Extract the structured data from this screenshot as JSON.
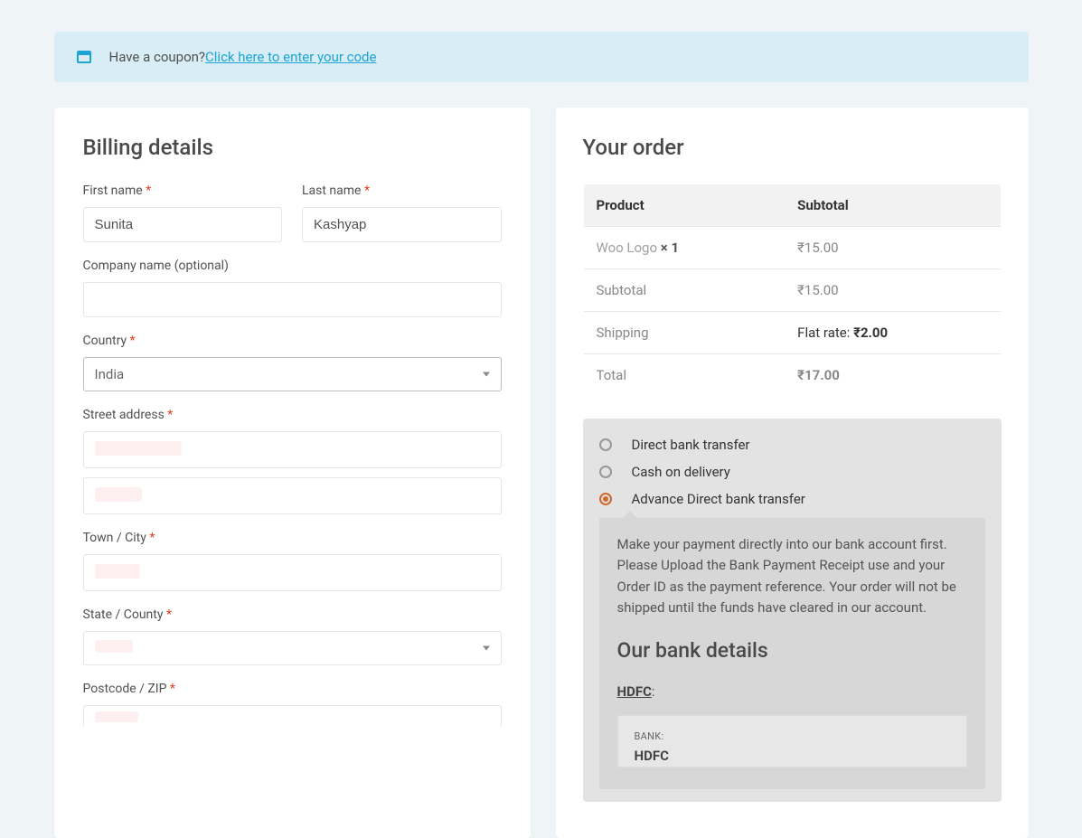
{
  "coupon": {
    "text": "Have a coupon? ",
    "link": "Click here to enter your code"
  },
  "billing": {
    "title": "Billing details",
    "first_name_label": "First name ",
    "first_name_value": "Sunita",
    "last_name_label": "Last name ",
    "last_name_value": "Kashyap",
    "company_label": "Company name (optional)",
    "company_value": "",
    "country_label": "Country ",
    "country_value": "India",
    "street_label": "Street address ",
    "town_label": "Town / City ",
    "state_label": "State / County ",
    "postcode_label": "Postcode / ZIP "
  },
  "order": {
    "title": "Your order",
    "head_product": "Product",
    "head_subtotal": "Subtotal",
    "item_name": "Woo Logo  ",
    "item_qty": "× 1",
    "item_price": "₹15.00",
    "subtotal_label": "Subtotal",
    "subtotal_value": "₹15.00",
    "shipping_label": "Shipping",
    "shipping_text": "Flat rate: ",
    "shipping_value": "₹2.00",
    "total_label": "Total",
    "total_value": "₹17.00"
  },
  "payment": {
    "m1": "Direct bank transfer",
    "m2": "Cash on delivery",
    "m3": "Advance Direct bank transfer",
    "desc": "Make your payment directly into our bank account first. Please Upload the Bank Payment Receipt use and your Order ID as the payment reference. Your order will not be shipped until the funds have cleared in our account.",
    "bank_title": "Our bank details",
    "bank_name": "HDFC",
    "bank_label": "BANK:",
    "bank_value": "HDFC"
  }
}
